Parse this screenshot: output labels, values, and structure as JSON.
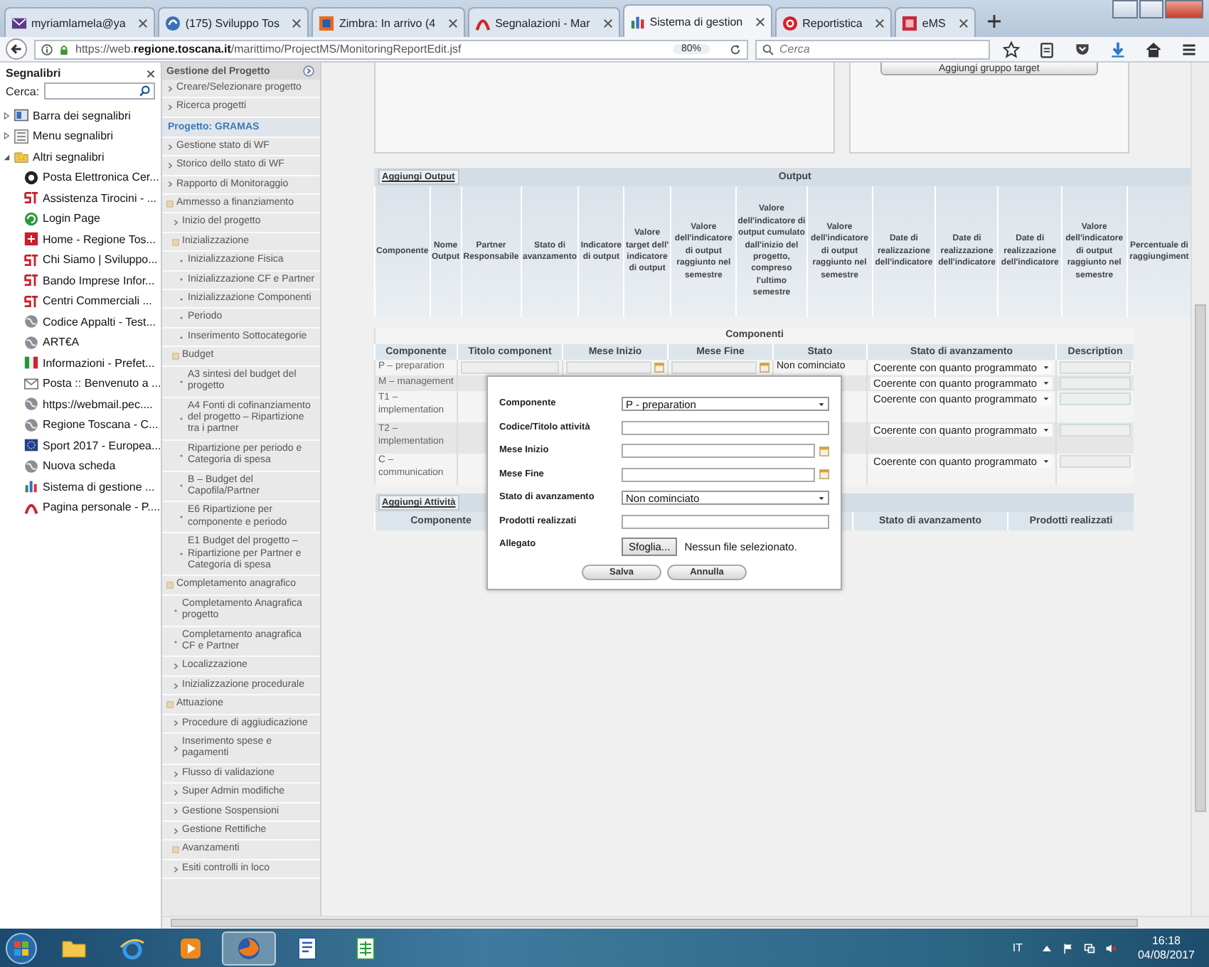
{
  "browser": {
    "tabs": [
      {
        "title": "myriamlamela@ya",
        "selected": false
      },
      {
        "title": "(175) Sviluppo Tos",
        "selected": false
      },
      {
        "title": "Zimbra: In arrivo (4",
        "selected": false
      },
      {
        "title": "Segnalazioni - Mar",
        "selected": false
      },
      {
        "title": "Sistema di gestion",
        "selected": true
      },
      {
        "title": "Reportistica",
        "selected": false
      },
      {
        "title": "eMS",
        "selected": false
      }
    ],
    "url": "https://web.**regione.toscana.it**/marittimo/ProjectMS/MonitoringReportEdit.jsf",
    "zoom": "80%",
    "search": {
      "placeholder": "Cerca"
    }
  },
  "bookmarks": {
    "title": "Segnalibri",
    "search_label": "Cerca:",
    "folders": [
      {
        "label": "Barra dei segnalibri",
        "expanded": false
      },
      {
        "label": "Menu segnalibri",
        "expanded": false
      },
      {
        "label": "Altri segnalibri",
        "expanded": true,
        "children": [
          {
            "label": "Posta Elettronica Cer..."
          },
          {
            "label": "Assistenza Tirocini - ..."
          },
          {
            "label": "Login Page"
          },
          {
            "label": "Home - Regione Tos..."
          },
          {
            "label": "Chi Siamo | Sviluppo..."
          },
          {
            "label": "Bando Imprese Infor..."
          },
          {
            "label": "Centri Commerciali ..."
          },
          {
            "label": "Codice Appalti - Test..."
          },
          {
            "label": "ART€A"
          },
          {
            "label": "Informazioni - Prefet..."
          },
          {
            "label": "Posta :: Benvenuto a ..."
          },
          {
            "label": "https://webmail.pec...."
          },
          {
            "label": "Regione Toscana - C..."
          },
          {
            "label": "Sport 2017 - Europea..."
          },
          {
            "label": "Nuova scheda"
          },
          {
            "label": "Sistema di gestione ..."
          },
          {
            "label": "Pagina personale - P...."
          }
        ]
      }
    ]
  },
  "nav": {
    "title": "Gestione del Progetto",
    "items": [
      {
        "label": "Creare/Selezionare progetto",
        "kind": "link"
      },
      {
        "label": "Ricerca progetti",
        "kind": "link"
      },
      {
        "label": "Progetto: GRAMAS",
        "kind": "heading"
      },
      {
        "label": "Gestione stato di WF",
        "kind": "link"
      },
      {
        "label": "Storico dello stato di WF",
        "kind": "link"
      },
      {
        "label": "Rapporto di Monitoraggio",
        "kind": "link"
      },
      {
        "label": "Ammesso a finanziamento",
        "kind": "group",
        "expanded": true,
        "children": [
          {
            "label": "Inizio del progetto",
            "kind": "link"
          },
          {
            "label": "Inizializzazione",
            "kind": "group",
            "expanded": true,
            "children": [
              {
                "label": "Inizializzazione Fisica",
                "kind": "bullet"
              },
              {
                "label": "Inizializzazione CF e Partner",
                "kind": "bullet"
              },
              {
                "label": "Inizializzazione Componenti",
                "kind": "bullet"
              },
              {
                "label": "Periodo",
                "kind": "bullet"
              },
              {
                "label": "Inserimento Sottocategorie",
                "kind": "bullet"
              }
            ]
          },
          {
            "label": "Budget",
            "kind": "group",
            "expanded": true,
            "children": [
              {
                "label": "A3 sintesi del budget del progetto",
                "kind": "bullet"
              },
              {
                "label": "A4 Fonti di cofinanziamento del progetto – Ripartizione tra i partner",
                "kind": "bullet"
              },
              {
                "label": "Ripartizione per periodo e Categoria di spesa",
                "kind": "bullet"
              },
              {
                "label": "B – Budget del Capofila/Partner",
                "kind": "bullet"
              },
              {
                "label": "E6 Ripartizione per componente e periodo",
                "kind": "bullet"
              },
              {
                "label": "E1 Budget del progetto – Ripartizione per Partner e Categoria di spesa",
                "kind": "bullet"
              }
            ]
          }
        ]
      },
      {
        "label": "Completamento anagrafico",
        "kind": "group",
        "expanded": true,
        "children": [
          {
            "label": "Completamento Anagrafica progetto",
            "kind": "bullet"
          },
          {
            "label": "Completamento anagrafica CF e Partner",
            "kind": "bullet"
          },
          {
            "label": "Localizzazione",
            "kind": "link"
          },
          {
            "label": "Inizializzazione procedurale",
            "kind": "link"
          }
        ]
      },
      {
        "label": "Attuazione",
        "kind": "group",
        "expanded": true,
        "children": [
          {
            "label": "Procedure di aggiudicazione",
            "kind": "link"
          },
          {
            "label": "Inserimento spese e pagamenti",
            "kind": "link"
          },
          {
            "label": "Flusso di validazione",
            "kind": "link"
          },
          {
            "label": "Super Admin modifiche",
            "kind": "link"
          },
          {
            "label": "Gestione Sospensioni",
            "kind": "link"
          },
          {
            "label": "Gestione Rettifiche",
            "kind": "link"
          },
          {
            "label": "Avanzamenti",
            "kind": "group",
            "expanded": true
          },
          {
            "label": "Esiti controlli in loco",
            "kind": "link"
          }
        ]
      }
    ]
  },
  "top_panel": {
    "button": "Aggiungi gruppo target"
  },
  "output_table": {
    "add_button": "Aggiungi Output",
    "title": "Output",
    "columns": [
      "Componente",
      "Nome Output",
      "Partner Responsabile",
      "Stato di avanzamento",
      "Indicatore di output",
      "Valore target dell' indicatore di output",
      "Valore dell'indicatore di output raggiunto nel semestre",
      "Valore dell'indicatore di output cumulato dall'inizio del progetto, compreso l'ultimo semestre",
      "Valore dell'indicatore di output raggiunto nel semestre",
      "Date di realizzazione dell'indicatore",
      "Date di realizzazione dell'indicatore",
      "Date di realizzazione dell'indicatore",
      "Valore dell'indicatore di output raggiunto nel semestre",
      "Percentuale di raggiungiment"
    ]
  },
  "components_table": {
    "title": "Componenti",
    "columns": [
      "Componente",
      "Titolo component",
      "Mese Inizio",
      "Mese Fine",
      "Stato",
      "Stato di avanzamento",
      "Description"
    ],
    "rows": [
      {
        "componente": "P – preparation",
        "stato": "Non cominciato",
        "avanzamento": "Coerente con quanto programmato"
      },
      {
        "componente": "M – management",
        "avanzamento": "Coerente con quanto programmato"
      },
      {
        "componente": "T1 – implementation",
        "avanzamento": "Coerente con quanto programmato"
      },
      {
        "componente": "T2 – implementation",
        "avanzamento": "Coerente con quanto programmato"
      },
      {
        "componente": "C – communication",
        "avanzamento": "Coerente con quanto programmato"
      }
    ]
  },
  "activities_table": {
    "add_button": "Aggiungi Attività",
    "columns": [
      "Componente",
      "Stato di avanzamento",
      "Prodotti realizzati"
    ]
  },
  "dialog": {
    "fields": [
      {
        "label": "Componente",
        "kind": "select",
        "value": "P - preparation"
      },
      {
        "label": "Codice/Titolo attività",
        "kind": "text"
      },
      {
        "label": "Mese Inizio",
        "kind": "date"
      },
      {
        "label": "Mese Fine",
        "kind": "date"
      },
      {
        "label": "Stato di avanzamento",
        "kind": "select",
        "value": "Non cominciato"
      },
      {
        "label": "Prodotti realizzati",
        "kind": "text"
      },
      {
        "label": "Allegato",
        "kind": "file",
        "button": "Sfoglia...",
        "value": "Nessun file selezionato."
      }
    ],
    "buttons": [
      "Salva",
      "Annulla"
    ]
  },
  "taskbar": {
    "apps": [
      {
        "selected": false
      },
      {
        "selected": false
      },
      {
        "selected": false
      },
      {
        "selected": true
      },
      {
        "selected": false
      },
      {
        "selected": false
      }
    ],
    "language": "IT",
    "time": "16:18",
    "date": "04/08/2017"
  }
}
